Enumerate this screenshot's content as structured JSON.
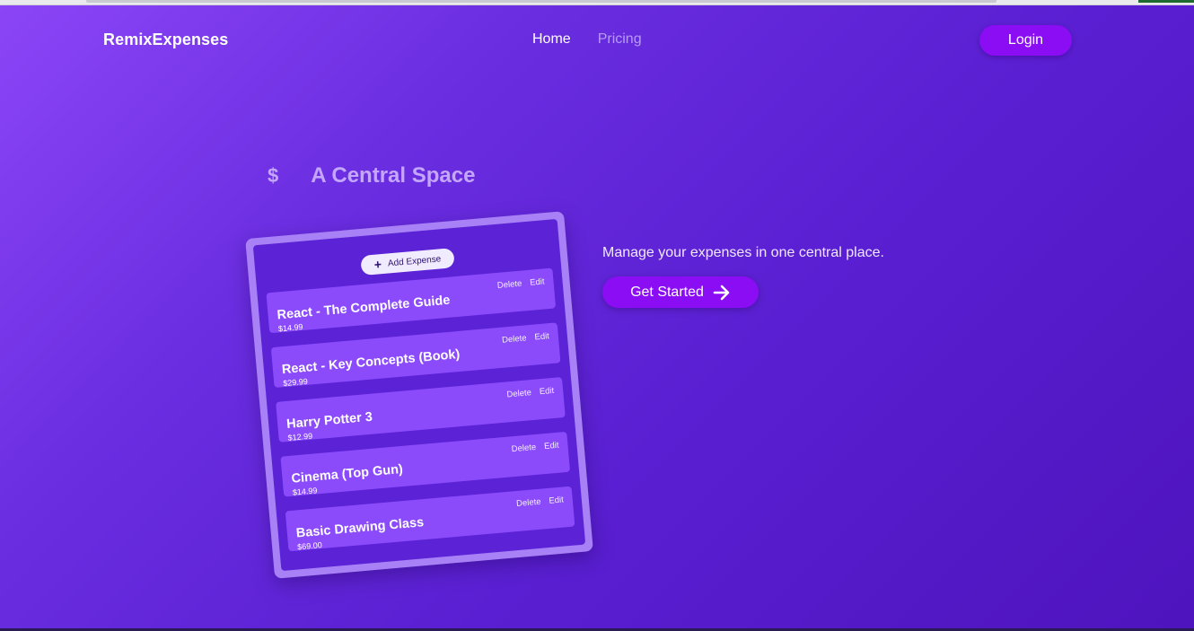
{
  "header": {
    "brand": "RemixExpenses",
    "nav": {
      "home": "Home",
      "pricing": "Pricing"
    },
    "login_label": "Login"
  },
  "hero": {
    "icon_glyph": "$",
    "title": "A Central Space",
    "tagline": "Manage your expenses in one central place.",
    "cta_label": "Get Started"
  },
  "card": {
    "add_label": "Add Expense",
    "delete_label": "Delete",
    "edit_label": "Edit",
    "expenses": [
      {
        "title": "React - The Complete Guide",
        "amount": "$14.99"
      },
      {
        "title": "React - Key Concepts (Book)",
        "amount": "$29.99"
      },
      {
        "title": "Harry Potter 3",
        "amount": "$12.99"
      },
      {
        "title": "Cinema (Top Gun)",
        "amount": "$14.99"
      },
      {
        "title": "Basic Drawing Class",
        "amount": "$69.00"
      }
    ]
  },
  "colors": {
    "accent": "#8a0df4",
    "gradient_start": "#8b45f7",
    "gradient_end": "#4e14bd",
    "expense_item": "#8b4bfb"
  }
}
